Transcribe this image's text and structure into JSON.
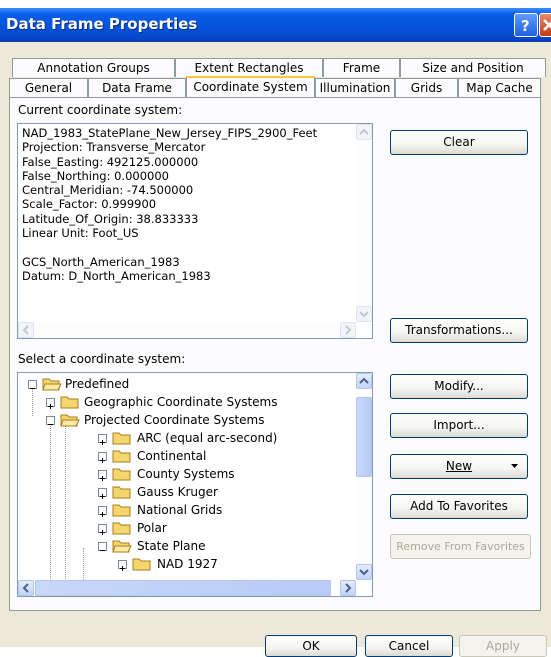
{
  "window": {
    "title": "Data Frame Properties"
  },
  "tabs": {
    "row_back": [
      "Annotation Groups",
      "Extent Rectangles",
      "Frame",
      "Size and Position"
    ],
    "row_front": [
      "General",
      "Data Frame",
      "Coordinate System",
      "Illumination",
      "Grids",
      "Map Cache"
    ],
    "active": "Coordinate System"
  },
  "current": {
    "label": "Current coordinate system:",
    "lines": [
      "NAD_1983_StatePlane_New_Jersey_FIPS_2900_Feet",
      "Projection: Transverse_Mercator",
      "False_Easting: 492125.000000",
      "False_Northing: 0.000000",
      "Central_Meridian: -74.500000",
      "Scale_Factor: 0.999900",
      "Latitude_Of_Origin: 38.833333",
      "Linear Unit: Foot_US",
      "",
      "GCS_North_American_1983",
      "Datum: D_North_American_1983"
    ]
  },
  "select": {
    "label": "Select a coordinate system:",
    "tree": [
      "Predefined",
      "Geographic Coordinate Systems",
      "Projected Coordinate Systems",
      "ARC (equal arc-second)",
      "Continental",
      "County Systems",
      "Gauss Kruger",
      "National Grids",
      "Polar",
      "State Plane",
      "NAD 1927"
    ]
  },
  "buttons": {
    "clear": "Clear",
    "transformations": "Transformations...",
    "modify": "Modify...",
    "import": "Import...",
    "new": "New",
    "add_favorites": "Add To Favorites",
    "remove_favorites": "Remove From Favorites",
    "ok": "OK",
    "cancel": "Cancel",
    "apply": "Apply"
  },
  "colors": {
    "title_bar": "#0551d8",
    "dialog_bg": "#ece9d8",
    "active_tab_accent": "#ffc83c",
    "folder": "#f5d66e"
  },
  "icons": [
    "help-icon",
    "close-icon",
    "folder-icon",
    "folder-open-icon",
    "scroll-up-icon",
    "scroll-down-icon",
    "scroll-left-icon",
    "scroll-right-icon",
    "dropdown-arrow-icon"
  ]
}
